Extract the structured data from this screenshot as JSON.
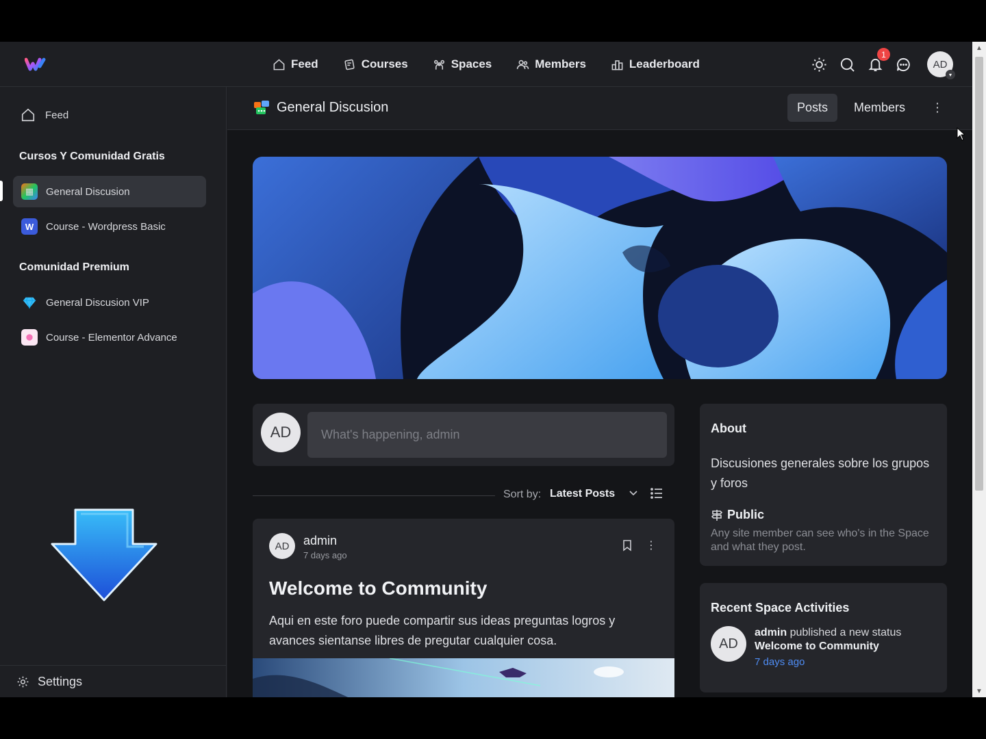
{
  "nav": {
    "feed": "Feed",
    "courses": "Courses",
    "spaces": "Spaces",
    "members": "Members",
    "leaderboard": "Leaderboard"
  },
  "topbar": {
    "notification_count": "1",
    "avatar": "AD"
  },
  "sidebar": {
    "feed": "Feed",
    "group1_heading": "Cursos Y Comunidad Gratis",
    "group1_items": [
      "General Discusion",
      "Course - Wordpress Basic"
    ],
    "group2_heading": "Comunidad Premium",
    "group2_items": [
      "General Discusion VIP",
      "Course - Elementor Advance"
    ],
    "settings": "Settings"
  },
  "space": {
    "title": "General Discusion",
    "tab_posts": "Posts",
    "tab_members": "Members"
  },
  "composer": {
    "avatar": "AD",
    "placeholder": "What's happening, admin"
  },
  "sort": {
    "label": "Sort by:",
    "value": "Latest Posts"
  },
  "post": {
    "avatar": "AD",
    "author": "admin",
    "time": "7 days ago",
    "title": "Welcome to Community",
    "body": "Aqui en este foro puede compartir sus ideas preguntas logros y avances sientanse libres de pregutar cualquier cosa."
  },
  "about": {
    "heading": "About",
    "description": "Discusiones generales sobre los grupos y foros",
    "privacy": "Public",
    "privacy_desc": "Any site member can see who's in the Space and what they post."
  },
  "recent": {
    "heading": "Recent Space Activities",
    "avatar": "AD",
    "actor": "admin",
    "action": " published a new status",
    "target": "Welcome to Community",
    "time": "7 days ago"
  },
  "colors": {
    "background": "#141518",
    "panel": "#1e1f23",
    "card": "#25262b",
    "accent_link": "#4f8df5",
    "badge": "#ef4444"
  }
}
